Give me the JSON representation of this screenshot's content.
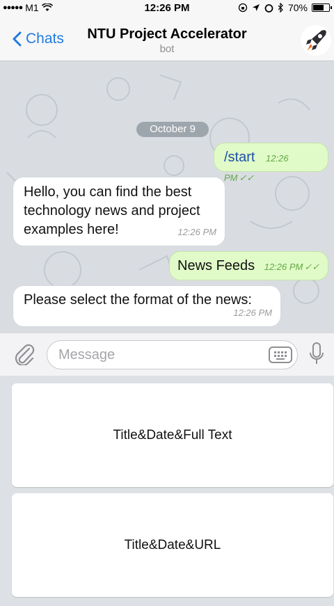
{
  "status_bar": {
    "carrier": "M1",
    "time": "12:26 PM",
    "battery": "70%",
    "battery_level": 0.7
  },
  "nav": {
    "back_label": "Chats",
    "title": "NTU Project Accelerator",
    "subtitle": "bot",
    "avatar_icon": "rocket-icon"
  },
  "chat": {
    "date": "October 9",
    "messages": [
      {
        "direction": "out",
        "text": "/start",
        "time": "12:26 PM"
      },
      {
        "direction": "in",
        "text": "Hello, you can find the best technology news and project examples here!",
        "time": "12:26 PM"
      },
      {
        "direction": "out",
        "text": "News Feeds",
        "time": "12:26 PM"
      },
      {
        "direction": "in",
        "text": "Please select the format of the news:",
        "time": "12:26 PM"
      }
    ]
  },
  "composer": {
    "placeholder": "Message",
    "attach_icon": "paperclip-icon",
    "keyboard_icon": "keyboard-icon",
    "mic_icon": "microphone-icon"
  },
  "keyboard": {
    "buttons": [
      {
        "label": "Title&Date&Full Text"
      },
      {
        "label": "Title&Date&URL"
      }
    ]
  },
  "colors": {
    "accent": "#1f7be0",
    "outgoing_bubble": "#e0fbc8",
    "incoming_bubble": "#ffffff",
    "chat_background": "#d9dde2",
    "timestamp_green": "#62a844"
  }
}
